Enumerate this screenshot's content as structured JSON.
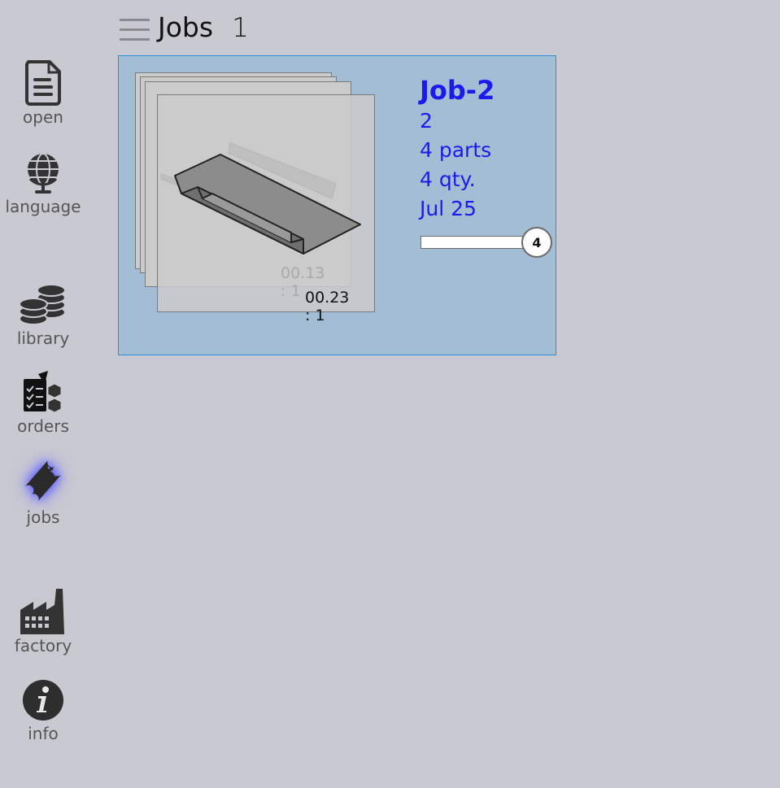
{
  "header": {
    "title": "Jobs",
    "count": "1"
  },
  "sidebar": {
    "items": [
      {
        "label": "open",
        "icon": "document-icon"
      },
      {
        "label": "language",
        "icon": "globe-icon"
      },
      {
        "label": "library",
        "icon": "coin-stack-icon"
      },
      {
        "label": "orders",
        "icon": "clipboard-boxes-icon"
      },
      {
        "label": "jobs",
        "icon": "ticket-icon",
        "active": true
      },
      {
        "label": "factory",
        "icon": "factory-icon"
      },
      {
        "label": "info",
        "icon": "info-icon"
      }
    ]
  },
  "jobs": [
    {
      "name": "Job-2",
      "number": "2",
      "parts": "4 parts",
      "qty": "4 qty.",
      "date": "Jul 25",
      "ratio_back": "00.13 : 1",
      "ratio_front": "00.23 : 1",
      "progress_badge": "4",
      "progress": 0
    }
  ],
  "colors": {
    "background": "#c9c9d2",
    "card": "#a3bed4",
    "card_border": "#2a8fd6",
    "job_text": "#1a1aee",
    "active_glow": "#5555ff"
  }
}
